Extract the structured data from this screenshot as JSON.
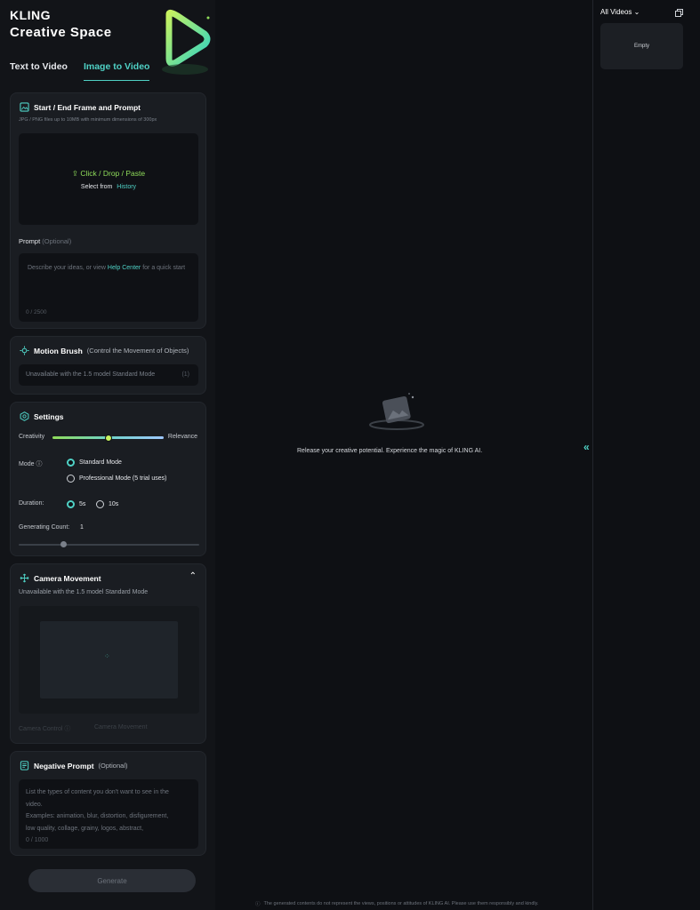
{
  "brand": {
    "line1": "KLING",
    "line2": "Creative Space"
  },
  "tabs": [
    {
      "label": "Text to Video"
    },
    {
      "label": "Image to Video"
    }
  ],
  "frame": {
    "title": "Start / End Frame and Prompt",
    "hint": "JPG / PNG files up to 10MB with minimum dimensions of 300px",
    "upload_label": "Click / Drop / Paste",
    "select_from": "Select from",
    "history_link": "History"
  },
  "prompt": {
    "label": "Prompt",
    "optional": "(Optional)",
    "placeholder_pre": "Describe your ideas, or view",
    "help_link": "Help Center",
    "placeholder_post": "for a quick start",
    "counter": "0 / 2500"
  },
  "motion": {
    "title": "Motion Brush",
    "sub": "(Control the Movement of Objects)",
    "unavailable": "Unavailable with the 1.5 model Standard Mode",
    "count": "(1)"
  },
  "settings": {
    "title": "Settings",
    "creativity": "Creativity",
    "relevance": "Relevance",
    "slider_value": 0.5,
    "mode_label": "Mode",
    "modes": [
      {
        "label": "Standard Mode",
        "selected": true
      },
      {
        "label": "Professional Mode (5 trial uses)",
        "selected": false
      }
    ],
    "duration_label": "Duration:",
    "durations": [
      {
        "label": "5s",
        "selected": true
      },
      {
        "label": "10s",
        "selected": false
      }
    ],
    "count_label": "Generating Count:",
    "count_value": "1",
    "count_slider_fraction": 0.25
  },
  "camera": {
    "title": "Camera Movement",
    "unavailable": "Unavailable with the 1.5 model Standard Mode",
    "control_label": "Camera Control",
    "movement_label": "Camera Movement"
  },
  "negative": {
    "title": "Negative Prompt",
    "optional": "(Optional)",
    "line1": "List the types of content you don't want to see in the",
    "line2": "video.",
    "line3": "Examples: animation, blur, distortion, disfigurement,",
    "line4": "low quality, collage, grainy, logos, abstract,",
    "counter": "0 / 1000"
  },
  "generate_label": "Generate",
  "main": {
    "message": "Release your creative potential. Experience the magic of KLING AI."
  },
  "right_panel": {
    "filter": "All Videos",
    "empty": "Empty"
  },
  "footer": "The generated contents do not represent the views, positions or attitudes of KLING AI. Please use them responsibly and kindly.",
  "colors": {
    "accent": "#4fd1c5",
    "green": "#8fdc5a",
    "background": "#0e1014"
  }
}
